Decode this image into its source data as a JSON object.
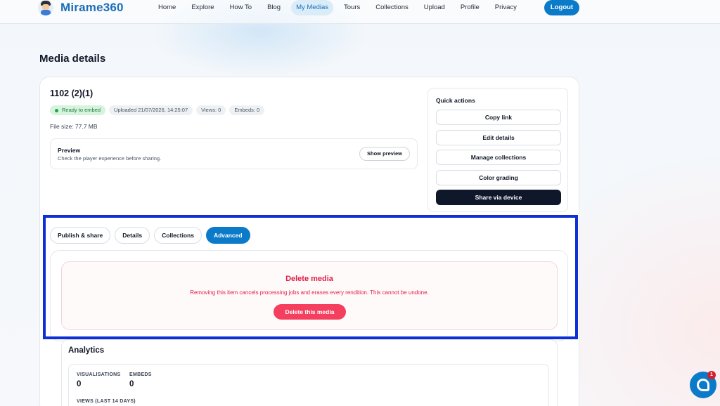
{
  "brand": {
    "name": "Mirame360"
  },
  "nav": {
    "items": [
      {
        "label": "Home",
        "active": false
      },
      {
        "label": "Explore",
        "active": false
      },
      {
        "label": "How To",
        "active": false
      },
      {
        "label": "Blog",
        "active": false
      },
      {
        "label": "My Medias",
        "active": true
      },
      {
        "label": "Tours",
        "active": false
      },
      {
        "label": "Collections",
        "active": false
      },
      {
        "label": "Upload",
        "active": false
      },
      {
        "label": "Profile",
        "active": false
      },
      {
        "label": "Privacy",
        "active": false
      }
    ],
    "logout_label": "Logout"
  },
  "page": {
    "title": "Media details"
  },
  "media": {
    "title": "1102 (2)(1)",
    "status": "Ready to embed",
    "uploaded": "Uploaded 21/07/2026, 14:25:07",
    "views": "Views: 0",
    "embeds": "Embeds: 0",
    "file_size": "File size: 77.7 MB"
  },
  "preview": {
    "title": "Preview",
    "subtitle": "Check the player experience before sharing.",
    "button": "Show preview"
  },
  "quick_actions": {
    "title": "Quick actions",
    "items": [
      "Copy link",
      "Edit details",
      "Manage collections",
      "Color grading",
      "Share via device"
    ]
  },
  "tabs": [
    {
      "label": "Publish & share",
      "active": false
    },
    {
      "label": "Details",
      "active": false
    },
    {
      "label": "Collections",
      "active": false
    },
    {
      "label": "Advanced",
      "active": true
    }
  ],
  "delete": {
    "title": "Delete media",
    "description": "Removing this item cancels processing jobs and erases every rendition. This cannot be undone.",
    "button": "Delete this media"
  },
  "analytics": {
    "title": "Analytics",
    "visualisations_label": "VISUALISATIONS",
    "visualisations_value": "0",
    "embeds_label": "EMBEDS",
    "embeds_value": "0",
    "views_14_label": "VIEWS (LAST 14 DAYS)"
  },
  "chat": {
    "badge": "1"
  },
  "colors": {
    "accent": "#0b7bc9",
    "danger": "#e11d48",
    "highlight": "#0c2fd6",
    "success": "#22a447"
  }
}
